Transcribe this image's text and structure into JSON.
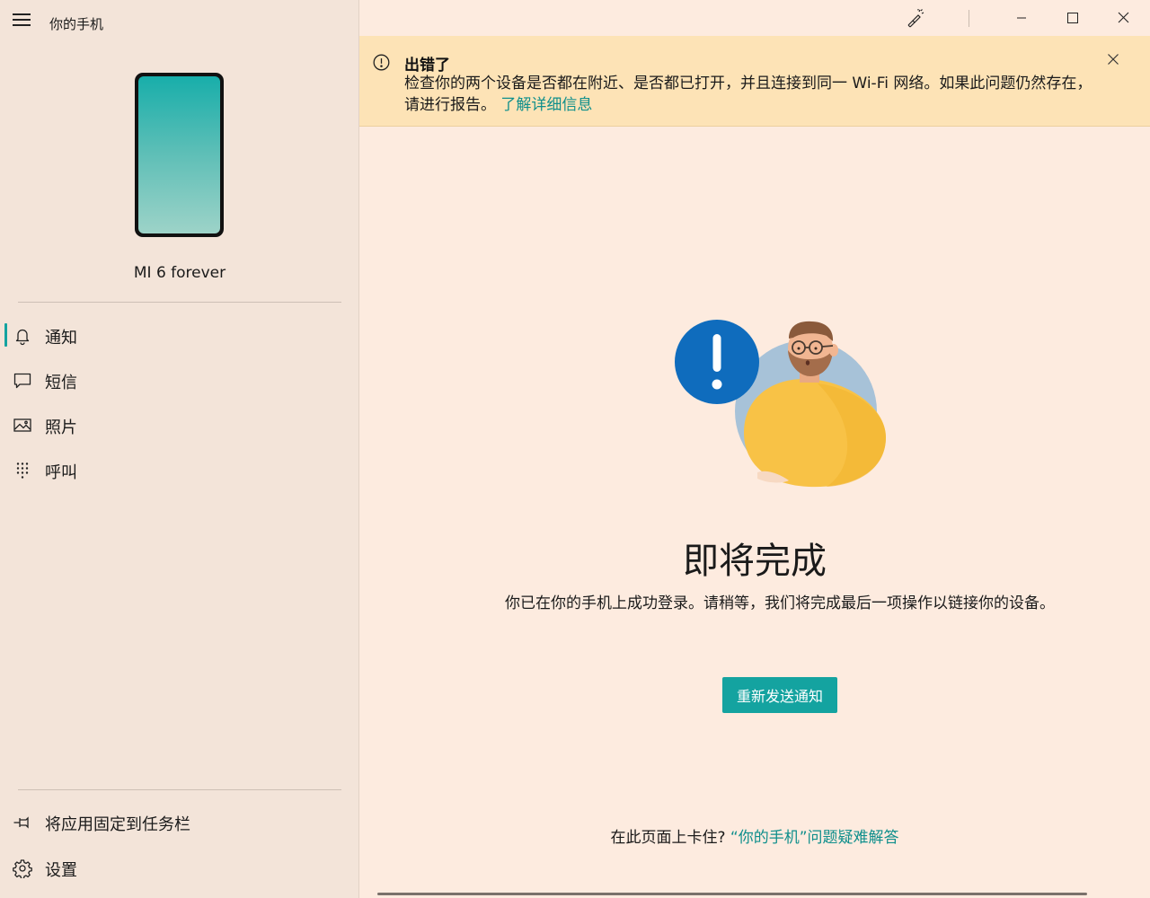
{
  "app": {
    "title": "你的手机"
  },
  "device": {
    "name": "MI 6 forever"
  },
  "nav": {
    "items": [
      {
        "label": "通知",
        "icon": "bell-icon",
        "active": true
      },
      {
        "label": "短信",
        "icon": "message-icon",
        "active": false
      },
      {
        "label": "照片",
        "icon": "photo-icon",
        "active": false
      },
      {
        "label": "呼叫",
        "icon": "dialpad-icon",
        "active": false
      }
    ],
    "footer": [
      {
        "label": "将应用固定到任务栏",
        "icon": "pin-icon"
      },
      {
        "label": "设置",
        "icon": "gear-icon"
      }
    ]
  },
  "banner": {
    "title": "出错了",
    "message": "检查你的两个设备是否都在附近、是否都已打开，并且连接到同一 Wi-Fi 网络。如果此问题仍然存在，请进行报告。",
    "link": "了解详细信息"
  },
  "content": {
    "heading": "即将完成",
    "description": "你已在你的手机上成功登录。请稍等，我们将完成最后一项操作以链接你的设备。",
    "resend_button": "重新发送通知"
  },
  "help": {
    "prefix": "在此页面上卡住? ",
    "link": "“你的手机”问题疑难解答"
  },
  "colors": {
    "accent": "#14a3a0",
    "sidebar_bg": "#f3e4d9",
    "main_bg": "#fdebdf",
    "banner_bg": "#fde3b6",
    "alert_blue": "#0f6cbd",
    "shirt_yellow": "#f8c246"
  }
}
